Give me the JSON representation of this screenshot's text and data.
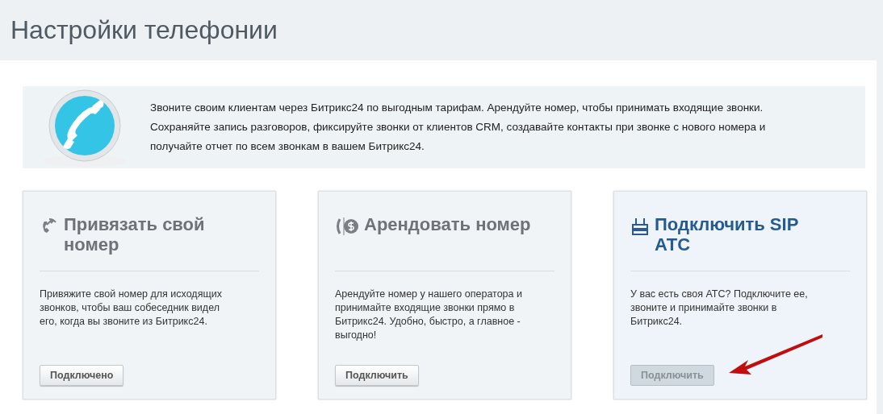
{
  "page_title": "Настройки телефонии",
  "intro": {
    "text": "Звоните своим клиентам через Битрикс24 по выгодным тарифам. Арендуйте номер, чтобы принимать входящие звонки. Сохраняйте запись разговоров, фиксируйте звонки от клиентов CRM, создавайте контакты при звонке с нового номера и получайте отчет по всем звонкам в вашем Битрикс24."
  },
  "cards": [
    {
      "kind": "link",
      "title": "Привязать свой номер",
      "description": "Привяжите свой номер для исходящих звонков, чтобы ваш собеседник видел его, когда вы звоните из Битрикс24.",
      "button": "Подключено",
      "selected": false
    },
    {
      "kind": "rent",
      "title": "Арендовать номер",
      "description": "Арендуйте номер у нашего оператора и принимайте входящие звонки прямо в Битрикс24. Удобно, быстро, а главное - выгодно!",
      "button": "Подключить",
      "selected": false
    },
    {
      "kind": "sip",
      "title": "Подключить SIP АТС",
      "description": "У вас есть своя АТС? Подключите ее, звоните и принимайте звонки в Битрикс24.",
      "button": "Подключить",
      "selected": true,
      "arrow": true
    }
  ]
}
